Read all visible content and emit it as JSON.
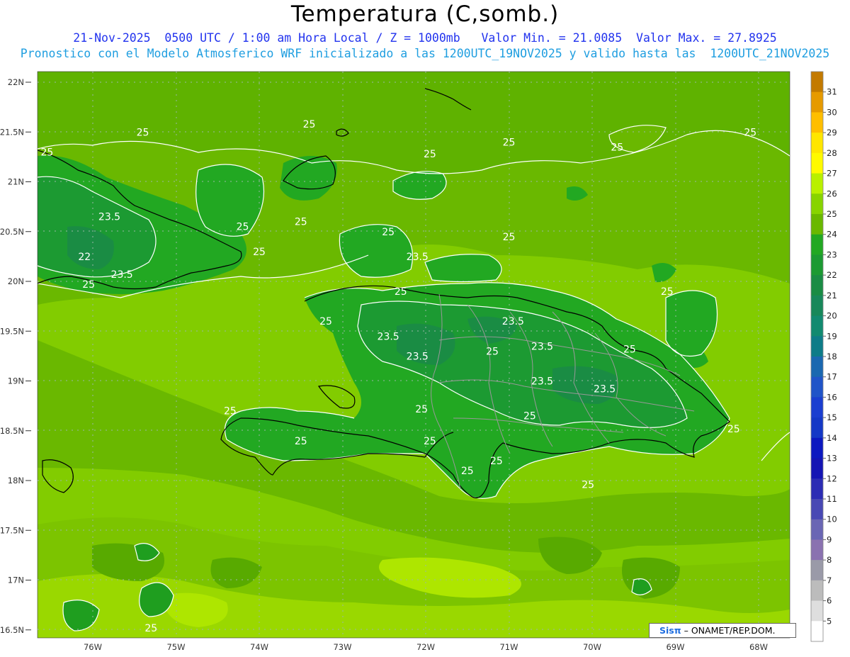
{
  "title": "Temperatura (C,somb.)",
  "subtitle_line1": "21-Nov-2025  0500 UTC / 1:00 am Hora Local / Z = 1000mb   Valor Min. = 21.0085  Valor Max. = 27.8925",
  "subtitle_line2": "Pronostico con el Modelo Atmosferico WRF inicializado a las 1200UTC_19NOV2025 y valido hasta las  1200UTC_21NOV2025",
  "footer_brand": "Sisπ",
  "footer_text": "– ONAMET/REP.DOM.",
  "lat_labels": [
    "22N",
    "21.5N",
    "21N",
    "20.5N",
    "20N",
    "19.5N",
    "19N",
    "18.5N",
    "18N",
    "17.5N",
    "17N",
    "16.5N"
  ],
  "lon_labels": [
    "76W",
    "75W",
    "74W",
    "73W",
    "72W",
    "71W",
    "70W",
    "69W",
    "68W"
  ],
  "colorbar": {
    "labels": [
      "31",
      "30",
      "29",
      "28",
      "27",
      "26",
      "25",
      "24",
      "23",
      "22",
      "21",
      "20",
      "19",
      "18",
      "17",
      "16",
      "15",
      "14",
      "13",
      "12",
      "11",
      "10",
      "9",
      "8",
      "7",
      "6",
      "5"
    ],
    "colors": [
      "#c37a00",
      "#e69a00",
      "#ffbe00",
      "#ffe600",
      "#fffa00",
      "#b9f000",
      "#88d400",
      "#6ab800",
      "#22a822",
      "#1c9a32",
      "#1a8c44",
      "#18885a",
      "#128a70",
      "#0e7c88",
      "#1a68b0",
      "#2054c8",
      "#1a3ed0",
      "#1438c6",
      "#0c18c0",
      "#1414b4",
      "#2c2cb4",
      "#4848b4",
      "#6a66b4",
      "#8a72b0",
      "#9a9aa8",
      "#bcbcbc",
      "#dedede",
      "#ffffff"
    ]
  },
  "contour_labels": [
    {
      "text": "25",
      "lat": 21.5,
      "lon": -75.4
    },
    {
      "text": "25",
      "lat": 21.58,
      "lon": -73.4
    },
    {
      "text": "25",
      "lat": 21.4,
      "lon": -71.0
    },
    {
      "text": "25",
      "lat": 21.5,
      "lon": -68.1
    },
    {
      "text": "25",
      "lat": 21.35,
      "lon": -69.7
    },
    {
      "text": "25",
      "lat": 21.28,
      "lon": -71.95
    },
    {
      "text": "25",
      "lat": 21.3,
      "lon": -76.55
    },
    {
      "text": "23.5",
      "lat": 20.65,
      "lon": -75.8
    },
    {
      "text": "25",
      "lat": 20.55,
      "lon": -74.2
    },
    {
      "text": "25",
      "lat": 20.6,
      "lon": -73.5
    },
    {
      "text": "25",
      "lat": 20.5,
      "lon": -72.45
    },
    {
      "text": "25",
      "lat": 20.45,
      "lon": -71.0
    },
    {
      "text": "25",
      "lat": 20.3,
      "lon": -74.0
    },
    {
      "text": "22",
      "lat": 20.25,
      "lon": -76.1
    },
    {
      "text": "23.5",
      "lat": 20.25,
      "lon": -72.1
    },
    {
      "text": "23.5",
      "lat": 20.07,
      "lon": -75.65
    },
    {
      "text": "25",
      "lat": 19.97,
      "lon": -76.05
    },
    {
      "text": "25",
      "lat": 19.9,
      "lon": -72.3
    },
    {
      "text": "25",
      "lat": 19.9,
      "lon": -69.1
    },
    {
      "text": "25",
      "lat": 19.6,
      "lon": -73.2
    },
    {
      "text": "23.5",
      "lat": 19.6,
      "lon": -70.95
    },
    {
      "text": "23.5",
      "lat": 19.45,
      "lon": -72.45
    },
    {
      "text": "23.5",
      "lat": 19.35,
      "lon": -70.6
    },
    {
      "text": "25",
      "lat": 19.32,
      "lon": -69.55
    },
    {
      "text": "25",
      "lat": 19.3,
      "lon": -71.2
    },
    {
      "text": "23.5",
      "lat": 19.25,
      "lon": -72.1
    },
    {
      "text": "23.5",
      "lat": 19.0,
      "lon": -70.6
    },
    {
      "text": "23.5",
      "lat": 18.92,
      "lon": -69.85
    },
    {
      "text": "25",
      "lat": 18.7,
      "lon": -74.35
    },
    {
      "text": "25",
      "lat": 18.72,
      "lon": -72.05
    },
    {
      "text": "25",
      "lat": 18.65,
      "lon": -70.75
    },
    {
      "text": "25",
      "lat": 18.52,
      "lon": -68.3
    },
    {
      "text": "25",
      "lat": 18.4,
      "lon": -73.5
    },
    {
      "text": "25",
      "lat": 18.4,
      "lon": -71.95
    },
    {
      "text": "25",
      "lat": 18.2,
      "lon": -71.15
    },
    {
      "text": "25",
      "lat": 18.1,
      "lon": -71.5
    },
    {
      "text": "25",
      "lat": 17.96,
      "lon": -70.05
    },
    {
      "text": "25",
      "lat": 16.52,
      "lon": -75.3
    }
  ]
}
